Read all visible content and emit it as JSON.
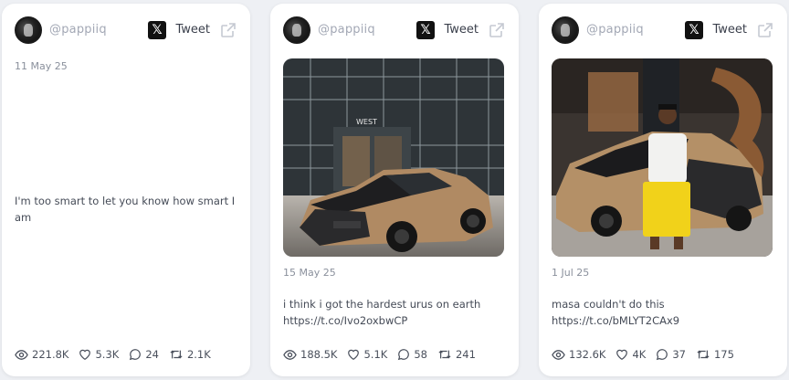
{
  "cards": [
    {
      "handle": "@pappiiq",
      "tweet_label": "Tweet",
      "date": "11 May 25",
      "text": "I'm too smart to let you know how smart I am",
      "link": "",
      "stats": {
        "views": "221.8K",
        "likes": "5.3K",
        "replies": "24",
        "retweets": "2.1K"
      }
    },
    {
      "handle": "@pappiiq",
      "tweet_label": "Tweet",
      "date": "15 May 25",
      "text": "i think i got the hardest urus on earth",
      "link": "https://t.co/Ivo2oxbwCP",
      "image": "photo of a tan and black Lamborghini Urus parked in front of a glass building",
      "stats": {
        "views": "188.5K",
        "likes": "5.1K",
        "replies": "58",
        "retweets": "241"
      }
    },
    {
      "handle": "@pappiiq",
      "tweet_label": "Tweet",
      "date": "1 Jul 25",
      "text": "masa couldn't do this",
      "link": "https://t.co/bMLYT2CAx9",
      "image": "photo of a man in yellow shorts standing next to a tan Lamborghini Urus in a garage",
      "stats": {
        "views": "132.6K",
        "likes": "4K",
        "replies": "37",
        "retweets": "175"
      }
    }
  ],
  "colors": {
    "background": "#eef0f4",
    "card": "#ffffff",
    "handle": "#a3a8b5",
    "text": "#454b57"
  },
  "icons": [
    "x-logo-icon",
    "external-link-icon",
    "eye-icon",
    "heart-icon",
    "comment-icon",
    "retweet-icon"
  ]
}
